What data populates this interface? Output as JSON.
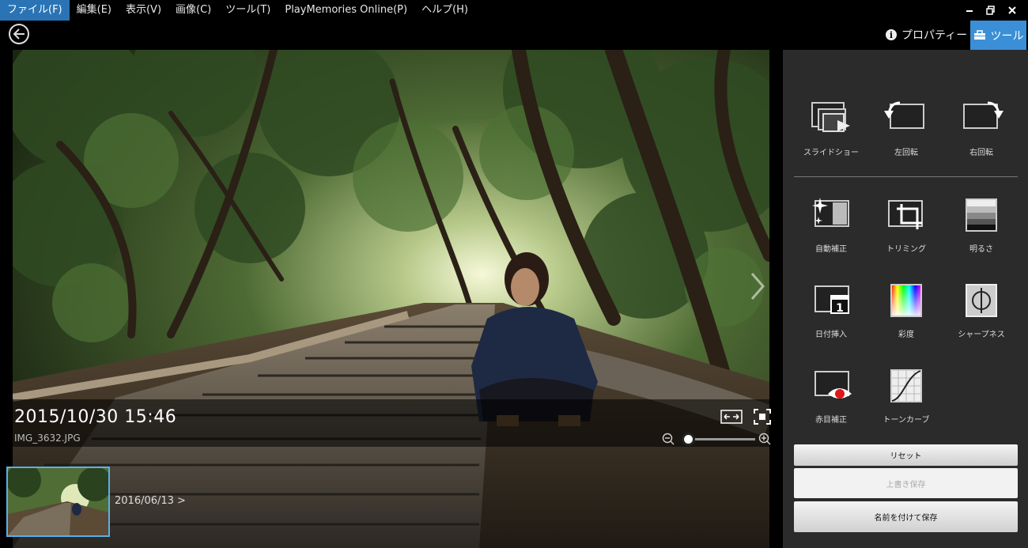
{
  "menu": {
    "items": [
      {
        "label": "ファイル(F)"
      },
      {
        "label": "編集(E)"
      },
      {
        "label": "表示(V)"
      },
      {
        "label": "画像(C)"
      },
      {
        "label": "ツール(T)"
      },
      {
        "label": "PlayMemories Online(P)"
      },
      {
        "label": "ヘルプ(H)"
      }
    ],
    "active_index": 0
  },
  "window_controls": {
    "minimize": "–",
    "restore": "❐",
    "close": "✕"
  },
  "toolbar": {
    "properties_label": "プロパティー",
    "tools_label": "ツール"
  },
  "viewer": {
    "datetime": "2015/10/30 15:46",
    "filename": "IMG_3632.JPG",
    "zoom_level": 0
  },
  "filmstrip": {
    "next_date": "2016/06/13 >"
  },
  "tools": {
    "row1": [
      {
        "label": "スライドショー",
        "icon": "slideshow-icon"
      },
      {
        "label": "左回転",
        "icon": "rotate-left-icon"
      },
      {
        "label": "右回転",
        "icon": "rotate-right-icon"
      }
    ],
    "row2": [
      {
        "label": "自動補正",
        "icon": "auto-correct-icon"
      },
      {
        "label": "トリミング",
        "icon": "trim-icon"
      },
      {
        "label": "明るさ",
        "icon": "brightness-icon"
      }
    ],
    "row3": [
      {
        "label": "日付挿入",
        "icon": "date-insert-icon"
      },
      {
        "label": "彩度",
        "icon": "saturation-icon"
      },
      {
        "label": "シャープネス",
        "icon": "sharpness-icon"
      }
    ],
    "row4": [
      {
        "label": "赤目補正",
        "icon": "red-eye-icon"
      },
      {
        "label": "トーンカーブ",
        "icon": "tone-curve-icon"
      }
    ]
  },
  "actions": {
    "reset": "リセット",
    "overwrite": "上書き保存",
    "save_as": "名前を付けて保存"
  },
  "colors": {
    "accent": "#3a8fd6",
    "panel": "#2b2b2b",
    "thumb_border": "#5ab0e8"
  }
}
